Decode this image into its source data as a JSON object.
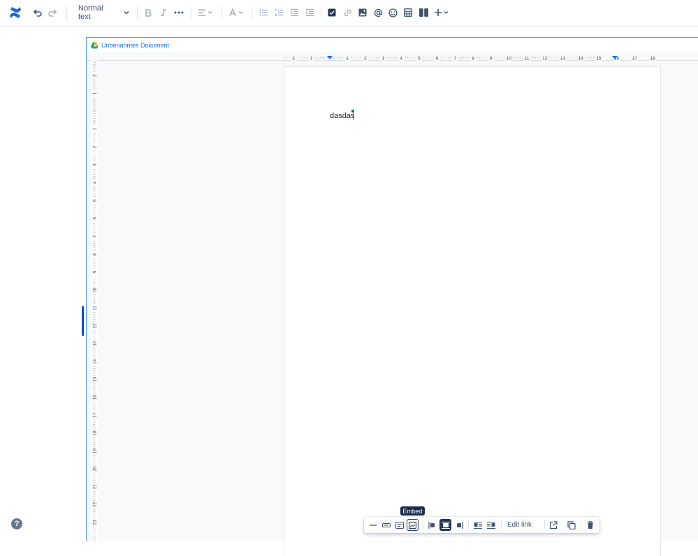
{
  "toolbar": {
    "text_style_label": "Normal text",
    "icons": [
      "confluence-logo-icon",
      "undo-icon",
      "redo-icon",
      "bold-icon",
      "italic-icon",
      "more-formatting-icon",
      "align-icon",
      "text-color-icon",
      "bullet-list-icon",
      "numbered-list-icon",
      "outdent-icon",
      "indent-icon",
      "action-item-icon",
      "link-icon",
      "image-icon",
      "mention-icon",
      "emoji-icon",
      "table-icon",
      "layouts-icon",
      "insert-more-icon"
    ]
  },
  "embed": {
    "title": "Unbenanntes Dokument",
    "ruler_top_labels": [
      "2",
      "1",
      "1",
      "2",
      "3",
      "4",
      "5",
      "6",
      "7",
      "8",
      "9",
      "10",
      "11",
      "12",
      "13",
      "14",
      "15",
      "16",
      "17",
      "18"
    ],
    "ruler_side_labels": [
      "2",
      "1",
      "1",
      "2",
      "3",
      "4",
      "5",
      "6",
      "7",
      "8",
      "9",
      "10",
      "11",
      "12",
      "13",
      "14",
      "15",
      "16",
      "17",
      "18",
      "19",
      "20",
      "21",
      "22",
      "23"
    ],
    "body_text": "dasdas"
  },
  "floating_toolbar": {
    "tooltip": "Embed",
    "edit_link_label": "Edit link"
  },
  "colors": {
    "accent": "#0052cc",
    "logo": "#1868db",
    "cursor": "#188038",
    "dark": "#253858"
  }
}
